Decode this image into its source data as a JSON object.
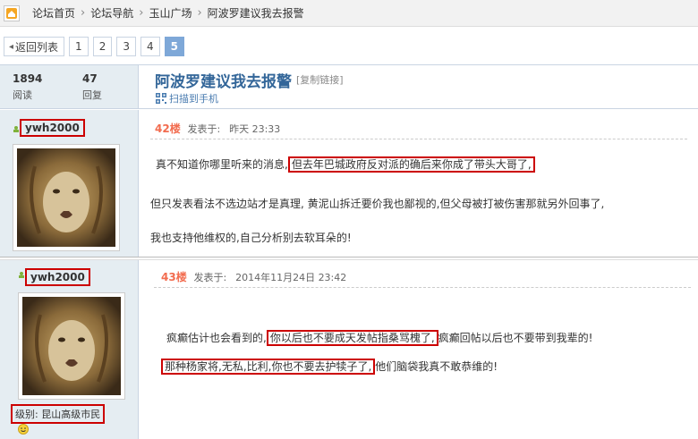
{
  "breadcrumb": {
    "items": [
      "论坛首页",
      "论坛导航",
      "玉山广场",
      "阿波罗建议我去报警"
    ],
    "separator": "›"
  },
  "pager": {
    "back_label": "返回列表",
    "pages": [
      "1",
      "2",
      "3",
      "4",
      "5"
    ],
    "current": "5"
  },
  "thread": {
    "views_value": "1894",
    "views_label": "阅读",
    "replies_value": "47",
    "replies_label": "回复",
    "title": "阿波罗建议我去报警",
    "copy_link": "[复制链接]",
    "scan_mobile": "扫描到手机"
  },
  "posts": [
    {
      "user": "ywh2000",
      "floor": "42楼",
      "posted_label": "发表于:",
      "time": "昨天  23:33",
      "lines": [
        {
          "pre": "真不知道你哪里听来的消息,",
          "hl": "但去年巴城政府反对派的确后来你成了带头大哥了,",
          "post": ""
        },
        {
          "pre": "但只发表看法不选边站才是真理,  黄泥山拆迁要价我也鄙视的,但父母被打被伤害那就另外回事了,",
          "hl": "",
          "post": ""
        },
        {
          "pre": "我也支持他维权的,自己分析别去软耳朵的!",
          "hl": "",
          "post": ""
        }
      ]
    },
    {
      "user": "ywh2000",
      "floor": "43楼",
      "posted_label": "发表于:",
      "time": "2014年11月24日  23:42",
      "lines": [
        {
          "pre": "疯癫估计也会看到的,",
          "hl": "你以后也不要成天发帖指桑骂槐了,",
          "post": "疯癫回帖以后也不要带到我辈的!"
        },
        {
          "pre": "",
          "hl": "那种杨家将,无私,比利,你也不要去护犊子了,",
          "post": "他们脑袋我真不敢恭维的!"
        }
      ],
      "level": "级别: 昆山高级市民"
    }
  ],
  "colors": {
    "accent": "#336699",
    "floor": "#f26c4f",
    "highlight_border": "#cc0000",
    "side_bg": "#e5edf2",
    "pager_current": "#7ea8d8"
  }
}
